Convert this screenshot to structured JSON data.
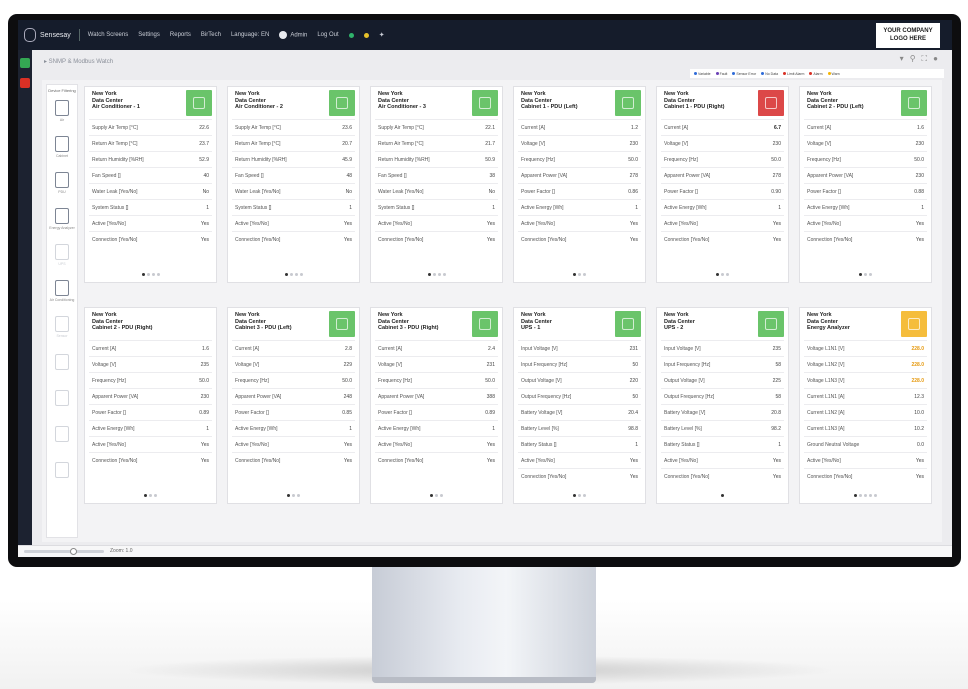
{
  "topbar": {
    "brand": "Sensesay",
    "nav": [
      "Watch Screens",
      "Settings",
      "Reports",
      "BirTech",
      "Language: EN",
      "Admin",
      "Log Out"
    ],
    "company_logo": "YOUR COMPANY LOGO HERE"
  },
  "breadcrumb": "▸ SNMP & Modbus Watch",
  "legend": [
    {
      "label": "Variable",
      "color": "#2f6bd8"
    },
    {
      "label": "Fault",
      "color": "#6a3fb5"
    },
    {
      "label": "Sensor Error",
      "color": "#2f6bd8"
    },
    {
      "label": "No Data",
      "color": "#2f6bd8"
    },
    {
      "label": "Limit Alarm",
      "color": "#d93025"
    },
    {
      "label": "Alarm",
      "color": "#d93025"
    },
    {
      "label": "Warn",
      "color": "#f5b400"
    }
  ],
  "sidebar": {
    "title": "Device Filtering",
    "items": [
      {
        "icon": "air-conditioner-icon",
        "label": "Air",
        "dim": false
      },
      {
        "icon": "cabinet-icon",
        "label": "Cabinet",
        "dim": false
      },
      {
        "icon": "pdu-icon",
        "label": "PDU",
        "dim": false
      },
      {
        "icon": "energy-analyzer-icon",
        "label": "Energy Analyzer",
        "dim": false
      },
      {
        "icon": "ups-icon",
        "label": "UPS",
        "dim": true
      },
      {
        "icon": "air-conditioning-icon",
        "label": "Air Conditioning",
        "dim": false
      },
      {
        "icon": "sensor-icon",
        "label": "Sensor",
        "dim": true
      },
      {
        "icon": "rack-icon",
        "label": "",
        "dim": true
      },
      {
        "icon": "server-icon",
        "label": "",
        "dim": true
      },
      {
        "icon": "fan-icon",
        "label": "",
        "dim": true
      },
      {
        "icon": "drop-icon",
        "label": "",
        "dim": true
      }
    ]
  },
  "cards": [
    {
      "name": [
        "New York",
        "Data Center",
        "Air Conditioner - 1"
      ],
      "status": "green",
      "rows": [
        [
          "Supply Air Temp [°C]",
          "22.6"
        ],
        [
          "Return Air Temp [°C]",
          "23.7"
        ],
        [
          "Return Humidity [%RH]",
          "52.9"
        ],
        [
          "Fan Speed []",
          "40"
        ],
        [
          "Water Leak [Yes/No]",
          "No"
        ],
        [
          "System Status []",
          "1"
        ],
        [
          "Active [Yes/No]",
          "Yes"
        ],
        [
          "Connection [Yes/No]",
          "Yes"
        ]
      ],
      "pages": 4,
      "page": 1
    },
    {
      "name": [
        "New York",
        "Data Center",
        "Air Conditioner - 2"
      ],
      "status": "green",
      "rows": [
        [
          "Supply Air Temp [°C]",
          "23.6"
        ],
        [
          "Return Air Temp [°C]",
          "20.7"
        ],
        [
          "Return Humidity [%RH]",
          "45.9"
        ],
        [
          "Fan Speed []",
          "48"
        ],
        [
          "Water Leak [Yes/No]",
          "No"
        ],
        [
          "System Status []",
          "1"
        ],
        [
          "Active [Yes/No]",
          "Yes"
        ],
        [
          "Connection [Yes/No]",
          "Yes"
        ]
      ],
      "pages": 4,
      "page": 1
    },
    {
      "name": [
        "New York",
        "Data Center",
        "Air Conditioner - 3"
      ],
      "status": "green",
      "rows": [
        [
          "Supply Air Temp [°C]",
          "22.1"
        ],
        [
          "Return Air Temp [°C]",
          "21.7"
        ],
        [
          "Return Humidity [%RH]",
          "50.9"
        ],
        [
          "Fan Speed []",
          "38"
        ],
        [
          "Water Leak [Yes/No]",
          "No"
        ],
        [
          "System Status []",
          "1"
        ],
        [
          "Active [Yes/No]",
          "Yes"
        ],
        [
          "Connection [Yes/No]",
          "Yes"
        ]
      ],
      "pages": 4,
      "page": 1
    },
    {
      "name": [
        "New York",
        "Data Center",
        "Cabinet 1 - PDU (Left)"
      ],
      "status": "green",
      "rows": [
        [
          "Current [A]",
          "1.2"
        ],
        [
          "Voltage [V]",
          "230"
        ],
        [
          "Frequency [Hz]",
          "50.0"
        ],
        [
          "Apparent Power [VA]",
          "278"
        ],
        [
          "Power Factor []",
          "0.86"
        ],
        [
          "Active Energy [Wh]",
          "1"
        ],
        [
          "Active [Yes/No]",
          "Yes"
        ],
        [
          "Connection [Yes/No]",
          "Yes"
        ]
      ],
      "pages": 3,
      "page": 1
    },
    {
      "name": [
        "New York",
        "Data Center",
        "Cabinet 1 - PDU (Right)"
      ],
      "status": "red",
      "rows": [
        [
          "Current [A]",
          "6.7"
        ],
        [
          "Voltage [V]",
          "230"
        ],
        [
          "Frequency [Hz]",
          "50.0"
        ],
        [
          "Apparent Power [VA]",
          "278"
        ],
        [
          "Power Factor []",
          "0.90"
        ],
        [
          "Active Energy [Wh]",
          "1"
        ],
        [
          "Active [Yes/No]",
          "Yes"
        ],
        [
          "Connection [Yes/No]",
          "Yes"
        ]
      ],
      "pages": 3,
      "page": 1,
      "bold_first": true
    },
    {
      "name": [
        "New York",
        "Data Center",
        "Cabinet 2 - PDU (Left)"
      ],
      "status": "green",
      "rows": [
        [
          "Current [A]",
          "1.6"
        ],
        [
          "Voltage [V]",
          "230"
        ],
        [
          "Frequency [Hz]",
          "50.0"
        ],
        [
          "Apparent Power [VA]",
          "230"
        ],
        [
          "Power Factor []",
          "0.88"
        ],
        [
          "Active Energy [Wh]",
          "1"
        ],
        [
          "Active [Yes/No]",
          "Yes"
        ],
        [
          "Connection [Yes/No]",
          "Yes"
        ]
      ],
      "pages": 3,
      "page": 1
    },
    {
      "name": [
        "New York",
        "Data Center",
        "Cabinet 2 - PDU (Right)"
      ],
      "status": "",
      "rows": [
        [
          "Current [A]",
          "1.6"
        ],
        [
          "Voltage [V]",
          "235"
        ],
        [
          "Frequency [Hz]",
          "50.0"
        ],
        [
          "Apparent Power [VA]",
          "230"
        ],
        [
          "Power Factor []",
          "0.89"
        ],
        [
          "Active Energy [Wh]",
          "1"
        ],
        [
          "Active [Yes/No]",
          "Yes"
        ],
        [
          "Connection [Yes/No]",
          "Yes"
        ]
      ],
      "pages": 3,
      "page": 1
    },
    {
      "name": [
        "New York",
        "Data Center",
        "Cabinet 3 - PDU (Left)"
      ],
      "status": "green",
      "rows": [
        [
          "Current [A]",
          "2.8"
        ],
        [
          "Voltage [V]",
          "229"
        ],
        [
          "Frequency [Hz]",
          "50.0"
        ],
        [
          "Apparent Power [VA]",
          "248"
        ],
        [
          "Power Factor []",
          "0.85"
        ],
        [
          "Active Energy [Wh]",
          "1"
        ],
        [
          "Active [Yes/No]",
          "Yes"
        ],
        [
          "Connection [Yes/No]",
          "Yes"
        ]
      ],
      "pages": 3,
      "page": 1
    },
    {
      "name": [
        "New York",
        "Data Center",
        "Cabinet 3 - PDU (Right)"
      ],
      "status": "green",
      "rows": [
        [
          "Current [A]",
          "2.4"
        ],
        [
          "Voltage [V]",
          "231"
        ],
        [
          "Frequency [Hz]",
          "50.0"
        ],
        [
          "Apparent Power [VA]",
          "388"
        ],
        [
          "Power Factor []",
          "0.89"
        ],
        [
          "Active Energy [Wh]",
          "1"
        ],
        [
          "Active [Yes/No]",
          "Yes"
        ],
        [
          "Connection [Yes/No]",
          "Yes"
        ]
      ],
      "pages": 3,
      "page": 1
    },
    {
      "name": [
        "New York",
        "Data Center",
        "UPS - 1"
      ],
      "status": "green",
      "rows": [
        [
          "Input Voltage [V]",
          "231"
        ],
        [
          "Input Frequency [Hz]",
          "50"
        ],
        [
          "Output Voltage [V]",
          "220"
        ],
        [
          "Output Frequency [Hz]",
          "50"
        ],
        [
          "Battery Voltage [V]",
          "20.4"
        ],
        [
          "Battery Level [%]",
          "98.8"
        ],
        [
          "Battery Status []",
          "1"
        ],
        [
          "Active [Yes/No]",
          "Yes"
        ],
        [
          "Connection [Yes/No]",
          "Yes"
        ]
      ],
      "pages": 3,
      "page": 1
    },
    {
      "name": [
        "New York",
        "Data Center",
        "UPS - 2"
      ],
      "status": "green",
      "rows": [
        [
          "Input Voltage [V]",
          "235"
        ],
        [
          "Input Frequency [Hz]",
          "58"
        ],
        [
          "Output Voltage [V]",
          "225"
        ],
        [
          "Output Frequency [Hz]",
          "58"
        ],
        [
          "Battery Voltage [V]",
          "20.8"
        ],
        [
          "Battery Level [%]",
          "98.2"
        ],
        [
          "Battery Status []",
          "1"
        ],
        [
          "Active [Yes/No]",
          "Yes"
        ],
        [
          "Connection [Yes/No]",
          "Yes"
        ]
      ],
      "pages": 1,
      "page": 1
    },
    {
      "name": [
        "New York",
        "Data Center",
        "Energy Analyzer"
      ],
      "status": "yellow",
      "rows": [
        [
          "Voltage L1N1 [V]",
          "228.0"
        ],
        [
          "Voltage L1N2 [V]",
          "228.0"
        ],
        [
          "Voltage L1N3 [V]",
          "228.0"
        ],
        [
          "Current L1N1 [A]",
          "12.3"
        ],
        [
          "Current L1N2 [A]",
          "10.0"
        ],
        [
          "Current L1N3 [A]",
          "10.2"
        ],
        [
          "Ground Neutral Voltage",
          "0.0"
        ],
        [
          "Active [Yes/No]",
          "Yes"
        ],
        [
          "Connection [Yes/No]",
          "Yes"
        ]
      ],
      "pages": 5,
      "page": 1,
      "orange_first": 3
    }
  ],
  "footer": {
    "zoom_label": "Zoom: 1.0"
  }
}
